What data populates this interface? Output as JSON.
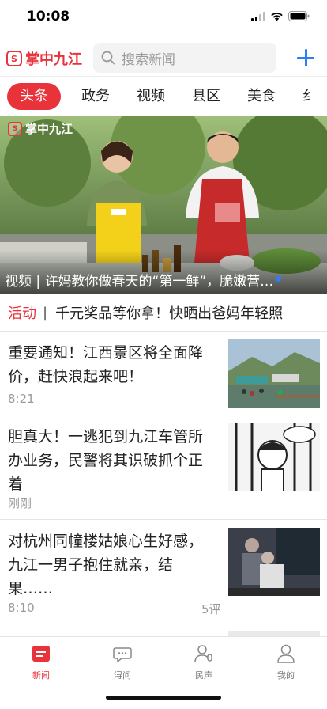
{
  "status_bar": {
    "time": "10:08"
  },
  "header": {
    "app_name": "掌中九江",
    "search_placeholder": "搜索新闻",
    "logo_mark": "S"
  },
  "tabs": [
    {
      "label": "头条",
      "active": true
    },
    {
      "label": "政务"
    },
    {
      "label": "视频"
    },
    {
      "label": "县区"
    },
    {
      "label": "美食"
    },
    {
      "label": "纟"
    }
  ],
  "hero": {
    "watermark": "掌中九江",
    "caption": "视频 | 许妈教你做春天的“第一鲜”，脆嫩营…"
  },
  "promo": {
    "tag": "活动",
    "separator": "|",
    "text": "千元奖品等你拿！快晒出爸妈年轻照"
  },
  "news": [
    {
      "title": "重要通知！江西景区将全面降价，赶快浪起来吧！",
      "time": "8:21",
      "comments": ""
    },
    {
      "title": "胆真大！一逃犯到九江车管所办业务，民警将其识破抓个正着",
      "time": "刚刚",
      "comments": ""
    },
    {
      "title": "对杭州同幢楼姑娘心生好感，九江一男子抱住就亲，结果……",
      "time": "8:10",
      "comments": "5评"
    }
  ],
  "tabbar": [
    {
      "label": "新闻",
      "icon": "news-icon",
      "active": true
    },
    {
      "label": "浔问",
      "icon": "chat-bubble-icon"
    },
    {
      "label": "民声",
      "icon": "voice-user-icon"
    },
    {
      "label": "我的",
      "icon": "profile-icon"
    }
  ],
  "colors": {
    "accent": "#e8333b",
    "blue": "#2e7cf6",
    "muted": "#9a9a9a"
  }
}
